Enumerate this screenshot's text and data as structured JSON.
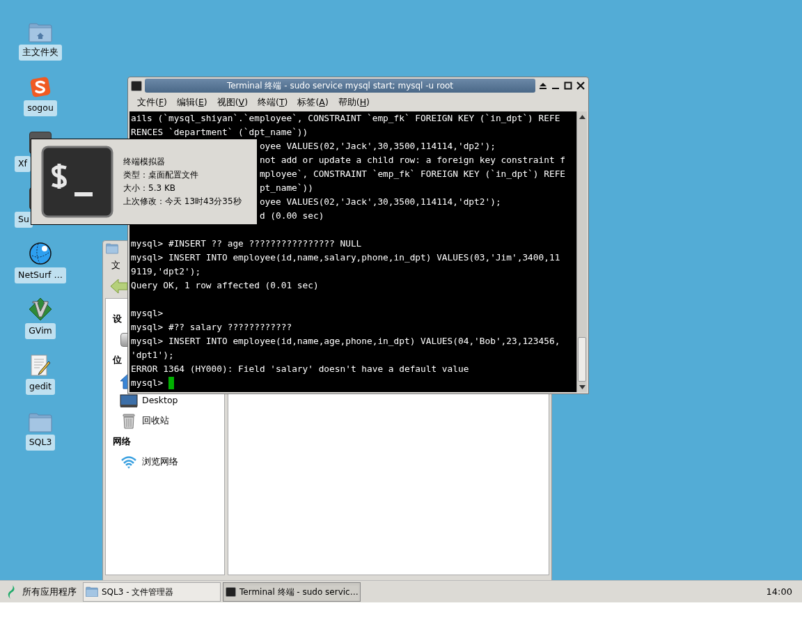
{
  "desktop_icons": [
    {
      "label": "主文件夹",
      "kind": "home-folder"
    },
    {
      "label": "sogou",
      "kind": "sogou"
    },
    {
      "label": "Xf",
      "kind": "app-dark"
    },
    {
      "label": "Su",
      "kind": "app-dark"
    },
    {
      "label": "NetSurf …",
      "kind": "globe"
    },
    {
      "label": "GVim",
      "kind": "vim"
    },
    {
      "label": "gedit",
      "kind": "editor"
    },
    {
      "label": "SQL3",
      "kind": "folder"
    }
  ],
  "file_manager": {
    "menu": [
      "文"
    ],
    "sidebar": [
      {
        "heading": "设",
        "items": [
          {
            "kind": "drive"
          }
        ]
      },
      {
        "heading": "位",
        "items": [
          {
            "kind": "home"
          },
          {
            "kind": "desktop",
            "label": "Desktop"
          },
          {
            "kind": "trash",
            "label": "回收站"
          }
        ]
      },
      {
        "heading": "网络",
        "items": [
          {
            "kind": "network",
            "label": "浏览网络"
          }
        ]
      }
    ]
  },
  "terminal": {
    "title": "Terminal 终端 - sudo service mysql start; mysql -u root",
    "menu": [
      "文件(F)",
      "编辑(E)",
      "视图(V)",
      "终端(T)",
      "标签(A)",
      "帮助(H)"
    ],
    "lines": [
      {
        "kind": "full",
        "text": "ails (`mysql_shiyan`.`employee`, CONSTRAINT `emp_fk` FOREIGN KEY (`in_dpt`) REFE"
      },
      {
        "kind": "full",
        "text": "RENCES `department` (`dpt_name`))"
      },
      {
        "kind": "partial",
        "text": "oyee VALUES(02,'Jack',30,3500,114114,'dp2');"
      },
      {
        "kind": "partial",
        "text": "not add or update a child row: a foreign key constraint f"
      },
      {
        "kind": "partial",
        "text": "mployee`, CONSTRAINT `emp_fk` FOREIGN KEY (`in_dpt`) REFE"
      },
      {
        "kind": "partial",
        "text": "pt_name`))"
      },
      {
        "kind": "partial",
        "text": "oyee VALUES(02,'Jack',30,3500,114114,'dpt2');"
      },
      {
        "kind": "partial",
        "text": "d (0.00 sec)"
      },
      {
        "kind": "blank"
      },
      {
        "kind": "full",
        "text": "mysql> #INSERT ?? age ???????????????? NULL"
      },
      {
        "kind": "full",
        "text": "mysql> INSERT INTO employee(id,name,salary,phone,in_dpt) VALUES(03,'Jim',3400,11"
      },
      {
        "kind": "full",
        "text": "9119,'dpt2');"
      },
      {
        "kind": "full",
        "text": "Query OK, 1 row affected (0.01 sec)"
      },
      {
        "kind": "blank"
      },
      {
        "kind": "full",
        "text": "mysql>"
      },
      {
        "kind": "full",
        "text": "mysql> #?? salary ????????????"
      },
      {
        "kind": "full",
        "text": "mysql> INSERT INTO employee(id,name,age,phone,in_dpt) VALUES(04,'Bob',23,123456,"
      },
      {
        "kind": "full",
        "text": "'dpt1');"
      },
      {
        "kind": "full",
        "text": "ERROR 1364 (HY000): Field 'salary' doesn't have a default value"
      },
      {
        "kind": "prompt",
        "text": "mysql>"
      }
    ]
  },
  "tooltip": {
    "lines": [
      "终端模拟器",
      "类型：桌面配置文件",
      "大小：5.3 KB",
      "上次修改：今天 13时43分35秒"
    ]
  },
  "taskbar": {
    "start": "所有应用程序",
    "tasks": [
      {
        "label": "SQL3 - 文件管理器",
        "kind": "folder",
        "selected": false
      },
      {
        "label": "Terminal 终端 - sudo servic…",
        "kind": "terminal",
        "selected": true
      }
    ],
    "clock": "14:00"
  }
}
